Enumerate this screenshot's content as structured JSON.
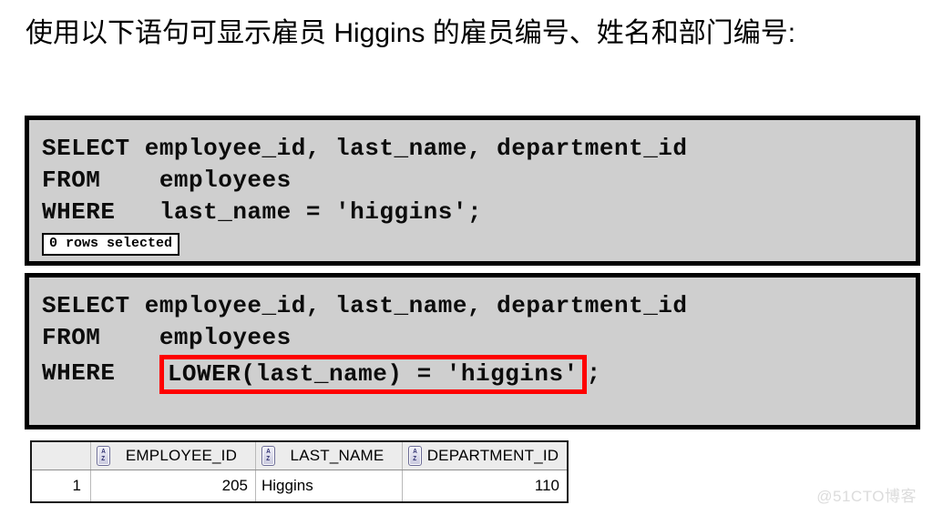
{
  "slide": {
    "heading": "使用以下语句可显示雇员 Higgins 的雇员编号、姓名和部门编号:",
    "watermark": "@51CTO博客"
  },
  "code_block_1": {
    "line1": "SELECT employee_id, last_name, department_id",
    "line2": "FROM    employees",
    "line3_prefix": "WHERE   last_name = 'higgins';",
    "result_badge": "0 rows selected"
  },
  "code_block_2": {
    "line1": "SELECT employee_id, last_name, department_id",
    "line2": "FROM    employees",
    "line3_keyword": "WHERE   ",
    "line3_highlight": "LOWER(last_name) = 'higgins'",
    "line3_suffix": ";",
    "highlight_color": "#ff0000"
  },
  "result_grid": {
    "headers": {
      "gutter": "",
      "employee_id": "EMPLOYEE_ID",
      "last_name": "LAST_NAME",
      "department_id": "DEPARTMENT_ID"
    },
    "header_icon": "az-datatype-icon",
    "header_icon_top_letter": "A",
    "header_icon_bottom_letter": "Z",
    "rows": [
      {
        "row_number": "1",
        "employee_id": "205",
        "last_name": "Higgins",
        "department_id": "110"
      }
    ]
  }
}
